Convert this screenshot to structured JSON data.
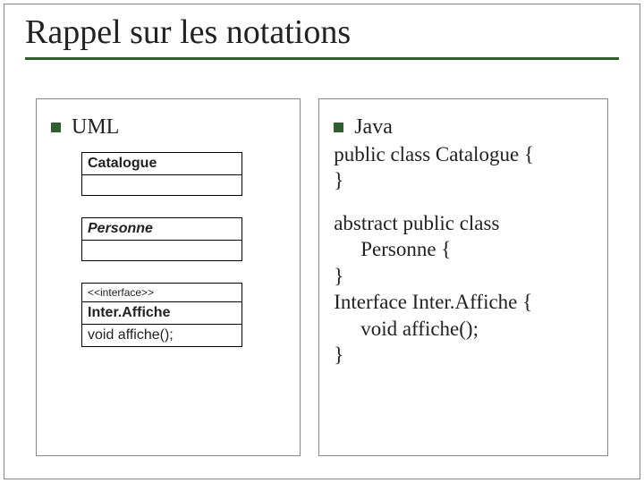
{
  "title": "Rappel sur les notations",
  "left": {
    "heading": "UML",
    "box1": {
      "name": "Catalogue"
    },
    "box2": {
      "name": "Personne"
    },
    "box3": {
      "stereotype": "<<interface>>",
      "name": "Inter.Affiche",
      "method": "void affiche();"
    }
  },
  "right": {
    "heading": "Java",
    "block1_l1": "public class Catalogue {",
    "block1_l2": "}",
    "block2_l1": "abstract public class",
    "block2_l2": "Personne {",
    "block2_l3": "}",
    "block2_l4": "Interface Inter.Affiche {",
    "block2_l5": "void affiche();",
    "block2_l6": "}"
  }
}
